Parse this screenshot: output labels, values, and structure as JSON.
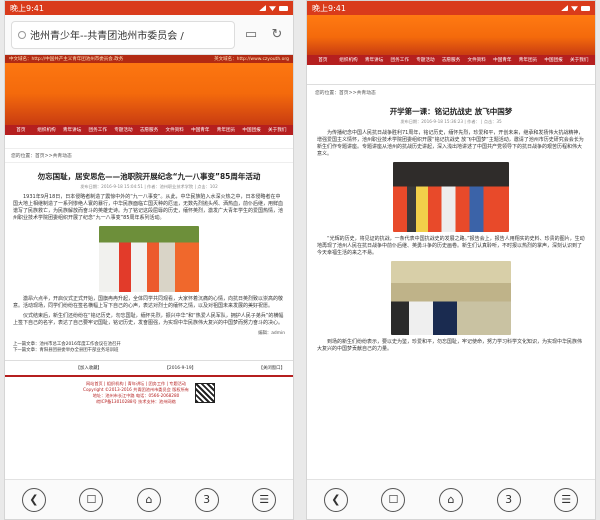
{
  "left": {
    "status_time": "晚上9:41",
    "url": "池州青少年--共青团池州市委员会 /",
    "banner_strip_left": "中文域名：http://中国共产主义青年团池州市委员会.政务",
    "banner_strip_right": "英文域名：http://www.czyouth.org",
    "nav": [
      "首页",
      "组织机构",
      "青年讲坛",
      "团务工作",
      "专题活动",
      "志愿服务",
      "文件资料",
      "中国青年",
      "青年团员",
      "中国团报",
      "关于我们"
    ],
    "breadcrumb": "您的位置：首页>>共青动态",
    "article_title": "勿忘国耻，居安思危——池职院开展纪念“九一八事变”85周年活动",
    "article_meta": "发布日期：2016-9-18 15:04:51  |  作者：池州职业技术学院  |  点击：102",
    "paragraphs": [
      "1931年9月18日，日本侵略者制造了震惊中外的“九一八事变”。从此，中华民族陷入水深火热之中，日本侵略者在中国大地上相继制造了一系列惨绝人寰的暴行，中华民族面临亡国灭种的厄运，无数先烈抛头颅、洒热血，前仆后继，用鲜血谱写了民族救亡，为民族解放而奋斗的英雄史诗。为了铭记这段屈辱的历史，缅怀英烈，激发广大青年学生的爱国热情，池州职业技术学院团委组织开展了纪念“九一八事变”85周年系列活动。",
      "激昂六点半，开启仪式正式开始，国旗冉冉升起，全体同学共同观看，大家怀着沉痛的心情，向抗日英烈致以崇高的敬意。活动现场，同学们纷纷在签名横幅上写下自己的心声，表达对烈士的缅怀之情，以及对祖国未来发展的美好祝愿。",
      "仪式结束后，新生们还纷纷在“铭记历史，勿忘国耻，缅怀先烈，振兴中华”和“热爱人民军队，拥护人民子弟兵”的横幅上签下自己的名字，表达了自己要牢记国耻，铭记历史，发奋图强，为实现中华民族伟大复兴的中国梦而努力奋斗的决心。"
    ],
    "editor": "编辑：admin",
    "prev_link": "上一篇文章：池州市总工会2016年度工作会议在池召开",
    "next_link": "下一篇文章：青阳县团县委举办全县团干部业务培训班",
    "collect_label": "【加入收藏】",
    "date_label": "【2016-9-19】",
    "close_label": "【关闭窗口】",
    "footer_lines": [
      "网站首页 | 组织机构 | 青年讲坛 | 团务工作 | 专题活动",
      "Copyright ©2013-2016 共青团池州市委员会 版权所有",
      "地址：池州市长江中路 电话：0566-2068280",
      "皖ICP备13010288号  技术支持：池州网络"
    ]
  },
  "right": {
    "status_time": "晚上9:41",
    "breadcrumb": "您的位置：首页>>共青动态",
    "article_title": "开学第一课：铭记抗战史 放飞中国梦",
    "article_meta": "发布日期：2016-9-18 15:36:23  |  作者：  |  点击：35",
    "paragraphs": [
      "为传播纪念中国人民抗日战争胜利71周年，铭记历史，缅怀先烈，珍爱和平，开创未来，继承和发扬伟大抗战精神，增强爱国主义情怀，池州职业技术学院团委组织开展“铭记抗战史 放飞中国梦”主题活动，邀请了池州市历史研究会会长为新生们作专题讲座。专题讲座从池州的抗战历史讲起，深入浅出地讲述了中国共产党领导下的抗日战争的艰苦历程和伟大意义。",
      "“光辉的历史，将见证的抗战，一条代表中国抗战史的发展之路。”报告会上，报告人用翔实的史料、珍贵的图片，生动地再现了池州人民在抗日战争中前仆后继、英勇斗争的历史画卷。新生们认真聆听，不时报以热烈的掌声，深刻认识到了今天幸福生活的来之不易。",
      "到场的新生们纷纷表示，要以史为鉴，珍爱和平，勿忘国耻，牢记使命，努力学习科学文化知识，为实现中华民族伟大复兴的中国梦贡献自己的力量。"
    ]
  },
  "bottom_nav": {
    "back": "❮",
    "book": "☐",
    "home": "⌂",
    "tabs": "3",
    "menu": "☰"
  },
  "colors": {
    "status_bar": "#d93b1b",
    "nav_red": "#b51f1f",
    "banner_orange": "#f46a0c"
  }
}
